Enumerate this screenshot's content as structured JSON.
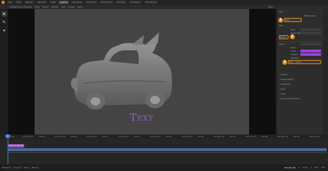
{
  "topbar": {
    "tabs": [
      {
        "label": "File"
      },
      {
        "label": "Edit"
      },
      {
        "label": "Render"
      },
      {
        "label": "Window"
      },
      {
        "label": "Help"
      },
      {
        "label": "Layout"
      },
      {
        "label": "Modeling"
      },
      {
        "label": "Sculpting"
      },
      {
        "label": "UV Editing"
      },
      {
        "label": "Shading"
      },
      {
        "label": "Animation"
      },
      {
        "label": "Rendering"
      }
    ]
  },
  "header2": {
    "items": [
      {
        "label": "Sequencer & Preview"
      },
      {
        "label": "View"
      },
      {
        "label": "Select"
      },
      {
        "label": "Marker"
      },
      {
        "label": "Add"
      },
      {
        "label": "Image"
      },
      {
        "label": "Strip"
      }
    ],
    "right_label": "Text"
  },
  "viewport": {
    "overlay_text": "Text"
  },
  "properties": {
    "header_label": "Text",
    "effect_strip_label": "Effect Strip",
    "text_label": "Text",
    "text_value": "Text",
    "size_label": "Size",
    "wrap_label": "Wrap Width",
    "style_label": "Style",
    "bold_label": "Bold",
    "italic_label": "Italic",
    "color_label": "Color",
    "outline_label": "Outline",
    "shadow_label": "Shadow",
    "box_label": "Box",
    "box_value": "0.01",
    "sections": [
      {
        "label": "Layout"
      },
      {
        "label": "Compositing"
      },
      {
        "label": "Transform"
      },
      {
        "label": "Crop"
      },
      {
        "label": "Time"
      },
      {
        "label": "Custom Properties"
      }
    ],
    "badges": {
      "one": "1",
      "two": "2",
      "three": "3"
    }
  },
  "timeline": {
    "ticks": [
      "01:00",
      "00:00+12",
      "00:01",
      "00:01+12",
      "00:02",
      "00:02+12",
      "00:03",
      "00:03+12",
      "00:04",
      "00:04+12",
      "00:05",
      "00:05+12",
      "00:06",
      "00:06+12",
      "00:07",
      "00:07+12",
      "00:08",
      "00:08+12",
      "00:09",
      "00:09+12"
    ],
    "strip_label": "Text | 0:00:16",
    "current_frame": "1"
  },
  "statusbar": {
    "items": [
      {
        "label": "Playback"
      },
      {
        "label": "Keying"
      },
      {
        "label": "View"
      },
      {
        "label": "Marker"
      }
    ],
    "right_values": [
      "1",
      "Start",
      "1",
      "End",
      "250"
    ]
  }
}
